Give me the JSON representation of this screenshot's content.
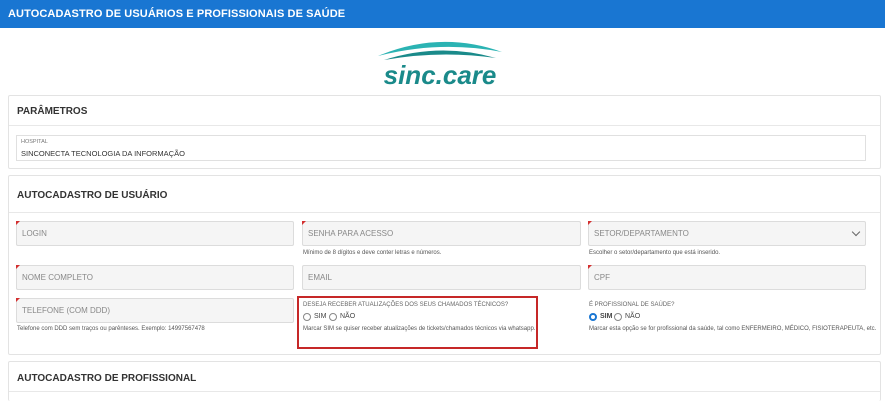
{
  "header": {
    "title": "AUTOCADASTRO DE USUÁRIOS E PROFISSIONAIS DE SAÚDE"
  },
  "logo": {
    "text": "sinc.care",
    "color": "#1a8a8a"
  },
  "parametros": {
    "title": "PARÂMETROS",
    "hospital_label": "HOSPITAL",
    "hospital_value": "SINCONECTA TECNOLOGIA DA INFORMAÇÃO"
  },
  "usuario": {
    "title": "AUTOCADASTRO DE USUÁRIO",
    "login_placeholder": "LOGIN",
    "senha_placeholder": "SENHA PARA ACESSO",
    "senha_help": "Mínimo de 8 dígitos e deve conter letras e números.",
    "setor_placeholder": "SETOR/DEPARTAMENTO",
    "setor_help": "Escolher o setor/departamento que está inserido.",
    "nome_placeholder": "NOME COMPLETO",
    "email_placeholder": "EMAIL",
    "cpf_placeholder": "CPF",
    "telefone_placeholder": "TELEFONE (COM DDD)",
    "telefone_help": "Telefone com DDD sem traços ou parênteses. Exemplo: 14997567478",
    "whatsapp_question": "DESEJA RECEBER ATUALIZAÇÕES DOS SEUS CHAMADOS TÉCNICOS?",
    "whatsapp_sim": "SIM",
    "whatsapp_nao": "NÃO",
    "whatsapp_help": "Marcar SIM se quiser receber atualizações de tickets/chamados técnicos via whatsapp.",
    "profissional_question": "É PROFISSIONAL DE SAÚDE?",
    "profissional_sim": "SIM",
    "profissional_nao": "NÃO",
    "profissional_selected": "SIM",
    "profissional_help": "Marcar esta opção se for profissional da saúde, tal como ENFERMEIRO, MÉDICO, FISIOTERAPEUTA, etc."
  },
  "profissional": {
    "title": "AUTOCADASTRO DE PROFISSIONAL"
  },
  "colors": {
    "primary": "#1976d2",
    "highlight": "#c62828",
    "required": "#d32f2f"
  }
}
